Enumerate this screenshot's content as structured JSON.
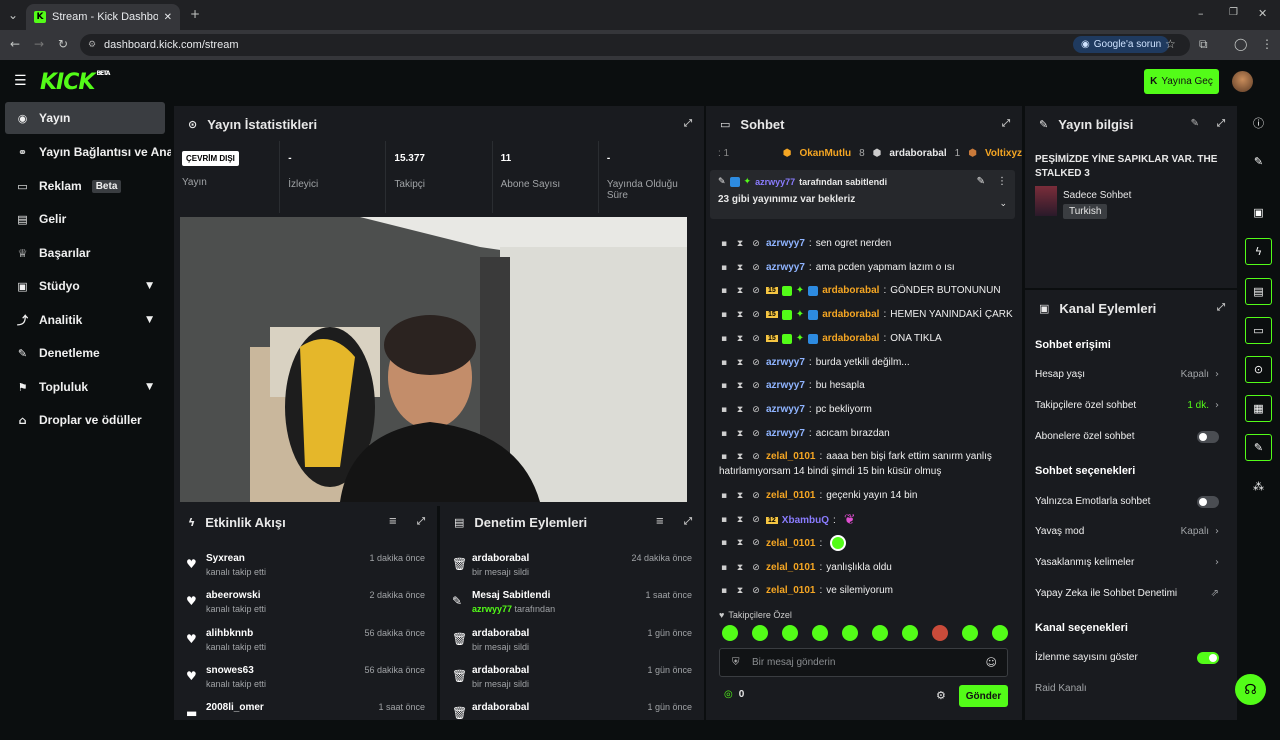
{
  "browser": {
    "tab_title": "Stream - Kick Dashboard",
    "url": "dashboard.kick.com/stream",
    "google_issue": "Google'a sorun"
  },
  "header": {
    "logo": "KICK",
    "logo_badge": "BETA",
    "go_live": "Yayına Geç"
  },
  "sidebar": {
    "items": [
      {
        "label": "Yayın",
        "icon": "broadcast-icon"
      },
      {
        "label": "Yayın Bağlantısı ve Anahtarı",
        "icon": "link-icon"
      },
      {
        "label": "Reklam",
        "icon": "ad-icon",
        "badge": "Beta"
      },
      {
        "label": "Gelir",
        "icon": "revenue-icon"
      },
      {
        "label": "Başarılar",
        "icon": "trophy-icon"
      },
      {
        "label": "Stüdyo",
        "icon": "studio-icon"
      },
      {
        "label": "Analitik",
        "icon": "analytics-icon"
      },
      {
        "label": "Denetleme",
        "icon": "wrench-icon"
      },
      {
        "label": "Topluluk",
        "icon": "community-icon"
      },
      {
        "label": "Droplar ve ödüller",
        "icon": "gift-icon"
      }
    ]
  },
  "stats": {
    "title": "Yayın İstatistikleri",
    "offline": "ÇEVRİM DIŞI",
    "items": [
      {
        "value": "",
        "label": "Yayın"
      },
      {
        "value": "-",
        "label": "İzleyici"
      },
      {
        "value": "15.377",
        "label": "Takipçi"
      },
      {
        "value": "11",
        "label": "Abone Sayısı"
      },
      {
        "value": "-",
        "label": "Yayında Olduğu Süre"
      }
    ]
  },
  "activity": {
    "title": "Etkinlik Akışı",
    "rows": [
      {
        "name": "Syxrean",
        "sub": "kanalı takip etti",
        "time": "1 dakika önce"
      },
      {
        "name": "abeerowski",
        "sub": "kanalı takip etti",
        "time": "2 dakika önce"
      },
      {
        "name": "alihbknnb",
        "sub": "kanalı takip etti",
        "time": "56 dakika önce"
      },
      {
        "name": "snowes63",
        "sub": "kanalı takip etti",
        "time": "56 dakika önce"
      },
      {
        "name": "2008li_omer",
        "sub": "",
        "time": "1 saat önce"
      }
    ]
  },
  "moderation": {
    "title": "Denetim Eylemleri",
    "rows": [
      {
        "name": "ardaborabal",
        "sub": "bir mesajı sildi",
        "time": "24 dakika önce"
      },
      {
        "name": "Mesaj Sabitlendi",
        "sub_user": "azrwyy77",
        "sub": "tarafından",
        "time": "1 saat önce"
      },
      {
        "name": "ardaborabal",
        "sub": "bir mesajı sildi",
        "time": "1 gün önce"
      },
      {
        "name": "ardaborabal",
        "sub": "bir mesajı sildi",
        "time": "1 gün önce"
      },
      {
        "name": "ardaborabal",
        "sub": "",
        "time": "1 gün önce"
      }
    ]
  },
  "chat": {
    "title": "Sohbet",
    "top": [
      {
        "rank": ": 1",
        "user": "",
        "count": ""
      },
      {
        "user": "OkanMutlu",
        "count": "8"
      },
      {
        "user": "ardaborabal",
        "count": "1"
      },
      {
        "user": "Voltixyz",
        "count": ""
      }
    ],
    "pinned_by_user": "azrwyy77",
    "pinned_by_text": "tarafından sabitlendi",
    "pinned_message": "23 gibi yayınımız var bekleriz",
    "messages": [
      {
        "user": "azrwyy7",
        "color": "#8fb4ff",
        "text": "sen ogret nerden"
      },
      {
        "user": "azrwyy7",
        "color": "#8fb4ff",
        "text": "ama pcden yapmam lazım o ısı"
      },
      {
        "user": "ardaborabal",
        "color": "#f5a623",
        "text": "GÖNDER BUTONUNUN"
      },
      {
        "user": "ardaborabal",
        "color": "#f5a623",
        "text": "HEMEN YANINDAKİ ÇARK"
      },
      {
        "user": "ardaborabal",
        "color": "#f5a623",
        "text": "ONA TIKLA"
      },
      {
        "user": "azrwyy7",
        "color": "#8fb4ff",
        "text": "burda yetkili değilm..."
      },
      {
        "user": "azrwyy7",
        "color": "#8fb4ff",
        "text": "bu hesapla"
      },
      {
        "user": "azrwyy7",
        "color": "#8fb4ff",
        "text": "pc bekliyorm"
      },
      {
        "user": "azrwyy7",
        "color": "#8fb4ff",
        "text": "acıcam bırazdan"
      },
      {
        "user": "zelal_0101",
        "color": "#f5a623",
        "text": "aaaa ben bişi fark ettim sanırm yanlış"
      },
      {
        "user": "zelal_0101",
        "color": "#f5a623",
        "text": "geçenki yayın 14 bin"
      },
      {
        "user": "XbambuQ",
        "color": "#8a7cff",
        "text": ""
      },
      {
        "user": "zelal_0101",
        "color": "#f5a623",
        "text": ""
      },
      {
        "user": "zelal_0101",
        "color": "#f5a623",
        "text": "yanlışlıkla oldu"
      },
      {
        "user": "zelal_0101",
        "color": "#f5a623",
        "text": "ve silemiyorum"
      }
    ],
    "wrap_line": "hatırlamıyorsam 14 bindi şimdi 15 bin küsür olmuş",
    "followers_only": "Takipçilere Özel",
    "placeholder": "Bir mesaj gönderin",
    "points": "0",
    "send": "Gönder"
  },
  "stream_info": {
    "title": "Yayın bilgisi",
    "stream_title": "PEŞİMİZDE YİNE SAPIKLAR VAR. THE STALKED 3",
    "category": "Sadece Sohbet",
    "tag": "Turkish"
  },
  "channel_actions": {
    "title": "Kanal Eylemleri",
    "chat_access": "Sohbet erişimi",
    "account_age": "Hesap yaşı",
    "account_age_val": "Kapalı",
    "followers_chat": "Takipçilere özel sohbet",
    "followers_chat_val": "1 dk.",
    "subs_chat": "Abonelere özel sohbet",
    "chat_options": "Sohbet seçenekleri",
    "emote_only": "Yalnızca Emotlarla sohbet",
    "slow_mode": "Yavaş mod",
    "slow_mode_val": "Kapalı",
    "banned_words": "Yasaklanmış kelimeler",
    "ai_mod": "Yapay Zeka ile Sohbet Denetimi",
    "channel_options": "Kanal seçenekleri",
    "show_viewers": "İzlenme sayısını göster",
    "raid": "Raid Kanalı"
  },
  "colors": {
    "accent": "#53fc18",
    "bg": "#0b0e0f",
    "panel": "#191b1f"
  }
}
